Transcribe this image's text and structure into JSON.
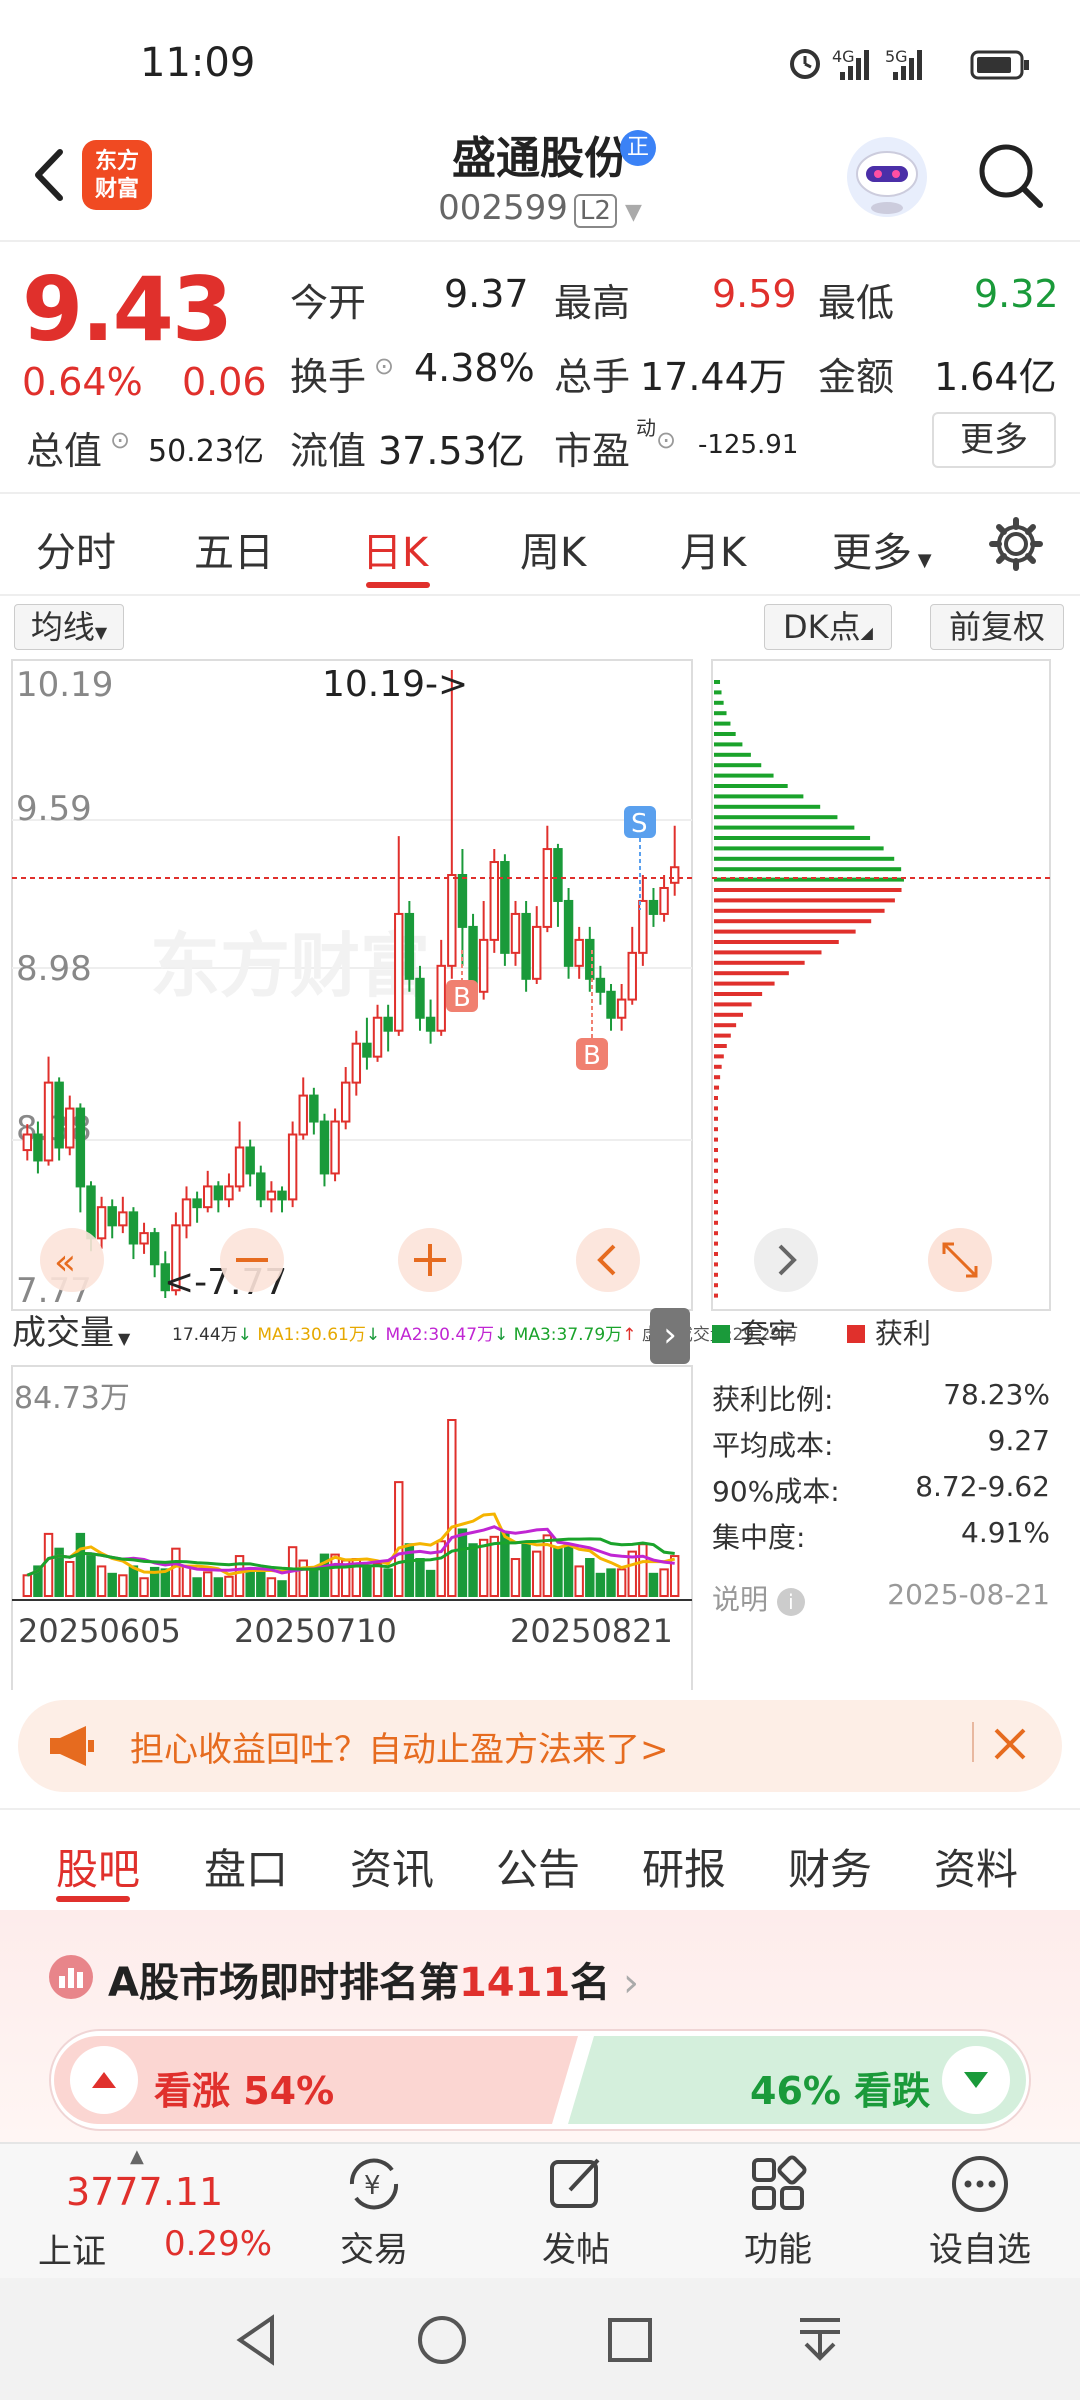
{
  "status": {
    "time": "11:09",
    "net1": "4G",
    "net2": "5G"
  },
  "header": {
    "logo_line1": "东方",
    "logo_line2": "财富",
    "stock_name": "盛通股份",
    "margin_badge": "正",
    "stock_code": "002599",
    "level_badge": "L2"
  },
  "quote": {
    "price": "9.43",
    "change_pct": "0.64%",
    "change": "0.06",
    "open_label": "今开",
    "open": "9.37",
    "high_label": "最高",
    "high": "9.59",
    "low_label": "最低",
    "low": "9.32",
    "turnover_label": "换手",
    "turnover": "4.38%",
    "volume_label": "总手",
    "volume": "17.44万",
    "amount_label": "金额",
    "amount": "1.64亿",
    "mktcap_label": "总值",
    "mktcap": "50.23亿",
    "float_label": "流值",
    "float_cap": "37.53亿",
    "pe_label": "市盈",
    "pe_sup": "动",
    "pe": "-125.91",
    "more_label": "更多"
  },
  "ktabs": [
    "分时",
    "五日",
    "日K",
    "周K",
    "月K",
    "更多"
  ],
  "chart_controls": {
    "ma_label": "均线",
    "dk_label": "DK点",
    "adjust_label": "前复权",
    "volume_label": "成交量"
  },
  "chart_data": {
    "type": "candlestick",
    "y_ticks": [
      "10.19",
      "9.59",
      "8.98",
      "8.38",
      "7.77"
    ],
    "max_label": "10.19->",
    "min_label": "<-7.77",
    "ylim": [
      7.77,
      10.19
    ],
    "candles": [
      [
        8.34,
        8.4,
        8.44,
        8.3
      ],
      [
        8.4,
        8.3,
        8.45,
        8.25
      ],
      [
        8.3,
        8.6,
        8.7,
        8.28
      ],
      [
        8.6,
        8.35,
        8.62,
        8.3
      ],
      [
        8.35,
        8.5,
        8.55,
        8.32
      ],
      [
        8.5,
        8.2,
        8.52,
        8.1
      ],
      [
        8.2,
        8.0,
        8.22,
        7.95
      ],
      [
        8.0,
        8.12,
        8.16,
        7.96
      ],
      [
        8.12,
        8.05,
        8.15,
        8.0
      ],
      [
        8.05,
        8.1,
        8.16,
        8.02
      ],
      [
        8.1,
        7.98,
        8.12,
        7.92
      ],
      [
        7.98,
        8.02,
        8.06,
        7.94
      ],
      [
        8.02,
        7.9,
        8.04,
        7.85
      ],
      [
        7.9,
        7.8,
        7.95,
        7.77
      ],
      [
        7.8,
        8.05,
        8.1,
        7.78
      ],
      [
        8.05,
        8.15,
        8.2,
        8.0
      ],
      [
        8.15,
        8.12,
        8.18,
        8.06
      ],
      [
        8.12,
        8.2,
        8.26,
        8.1
      ],
      [
        8.2,
        8.15,
        8.22,
        8.1
      ],
      [
        8.15,
        8.2,
        8.25,
        8.12
      ],
      [
        8.2,
        8.35,
        8.45,
        8.18
      ],
      [
        8.35,
        8.25,
        8.38,
        8.2
      ],
      [
        8.25,
        8.15,
        8.28,
        8.12
      ],
      [
        8.15,
        8.18,
        8.22,
        8.1
      ],
      [
        8.18,
        8.15,
        8.2,
        8.1
      ],
      [
        8.15,
        8.4,
        8.45,
        8.12
      ],
      [
        8.4,
        8.55,
        8.62,
        8.38
      ],
      [
        8.55,
        8.45,
        8.58,
        8.4
      ],
      [
        8.45,
        8.25,
        8.48,
        8.2
      ],
      [
        8.25,
        8.45,
        8.5,
        8.22
      ],
      [
        8.45,
        8.6,
        8.66,
        8.42
      ],
      [
        8.6,
        8.75,
        8.8,
        8.55
      ],
      [
        8.75,
        8.7,
        8.85,
        8.65
      ],
      [
        8.7,
        8.85,
        8.9,
        8.68
      ],
      [
        8.85,
        8.8,
        8.9,
        8.72
      ],
      [
        8.8,
        9.25,
        9.55,
        8.78
      ],
      [
        9.25,
        9.0,
        9.3,
        8.95
      ],
      [
        9.0,
        8.85,
        9.05,
        8.8
      ],
      [
        8.85,
        8.8,
        8.92,
        8.75
      ],
      [
        8.8,
        9.05,
        9.15,
        8.78
      ],
      [
        9.05,
        9.4,
        10.19,
        9.0
      ],
      [
        9.4,
        9.2,
        9.5,
        9.05
      ],
      [
        9.2,
        8.95,
        9.25,
        8.9
      ],
      [
        8.95,
        9.15,
        9.3,
        8.92
      ],
      [
        9.15,
        9.45,
        9.5,
        9.1
      ],
      [
        9.45,
        9.1,
        9.48,
        9.05
      ],
      [
        9.1,
        9.25,
        9.3,
        9.05
      ],
      [
        9.25,
        9.0,
        9.3,
        8.95
      ],
      [
        9.0,
        9.2,
        9.28,
        8.98
      ],
      [
        9.2,
        9.5,
        9.59,
        9.18
      ],
      [
        9.5,
        9.3,
        9.52,
        9.2
      ],
      [
        9.3,
        9.05,
        9.35,
        9.0
      ],
      [
        9.05,
        9.15,
        9.2,
        9.0
      ],
      [
        9.15,
        9.0,
        9.2,
        8.95
      ],
      [
        9.0,
        8.95,
        9.05,
        8.9
      ],
      [
        8.95,
        8.85,
        8.98,
        8.8
      ],
      [
        8.85,
        8.92,
        8.98,
        8.8
      ],
      [
        8.92,
        9.1,
        9.2,
        8.9
      ],
      [
        9.1,
        9.3,
        9.4,
        9.05
      ],
      [
        9.3,
        9.25,
        9.35,
        9.2
      ],
      [
        9.25,
        9.35,
        9.4,
        9.22
      ],
      [
        9.37,
        9.43,
        9.59,
        9.32
      ]
    ],
    "volume_max_label": "84.73万",
    "volume_legend": {
      "vol": "17.44万",
      "ma1": "MA1:30.61万",
      "ma2": "MA2:30.47万",
      "ma3": "MA3:37.79万",
      "virtual": "虚拟成交量:29.29万"
    },
    "dates": [
      "20250605",
      "20250710",
      "20250821"
    ],
    "colors": {
      "up": "#e0302c",
      "down": "#1a9a3a",
      "ma1": "#f5b400",
      "ma2": "#c026d3",
      "ma3": "#1aa32b"
    }
  },
  "chip_distribution": {
    "legend_trapped": "套牢",
    "legend_profit": "获利",
    "profit_ratio_label": "获利比例:",
    "profit_ratio": "78.23%",
    "avg_cost_label": "平均成本:",
    "avg_cost": "9.27",
    "cost90_label": "90%成本:",
    "cost90": "8.72-9.62",
    "concentration_label": "集中度:",
    "concentration": "4.91%",
    "note_label": "说明",
    "date": "2025-08-21"
  },
  "banner": {
    "text": "担心收益回吐？自动止盈方法来了>"
  },
  "bottom_tabs": [
    "股吧",
    "盘口",
    "资讯",
    "公告",
    "研报",
    "财务",
    "资料"
  ],
  "ranking": {
    "prefix": "A股市场即时排名第",
    "rank": "1411",
    "suffix": "名",
    "bull_label": "看涨 54%",
    "bear_label": "46% 看跌"
  },
  "bottom_nav": {
    "index_value": "3777.11",
    "index_name": "上证",
    "index_change": "0.29%",
    "items": [
      "交易",
      "发帖",
      "功能",
      "设自选"
    ]
  }
}
